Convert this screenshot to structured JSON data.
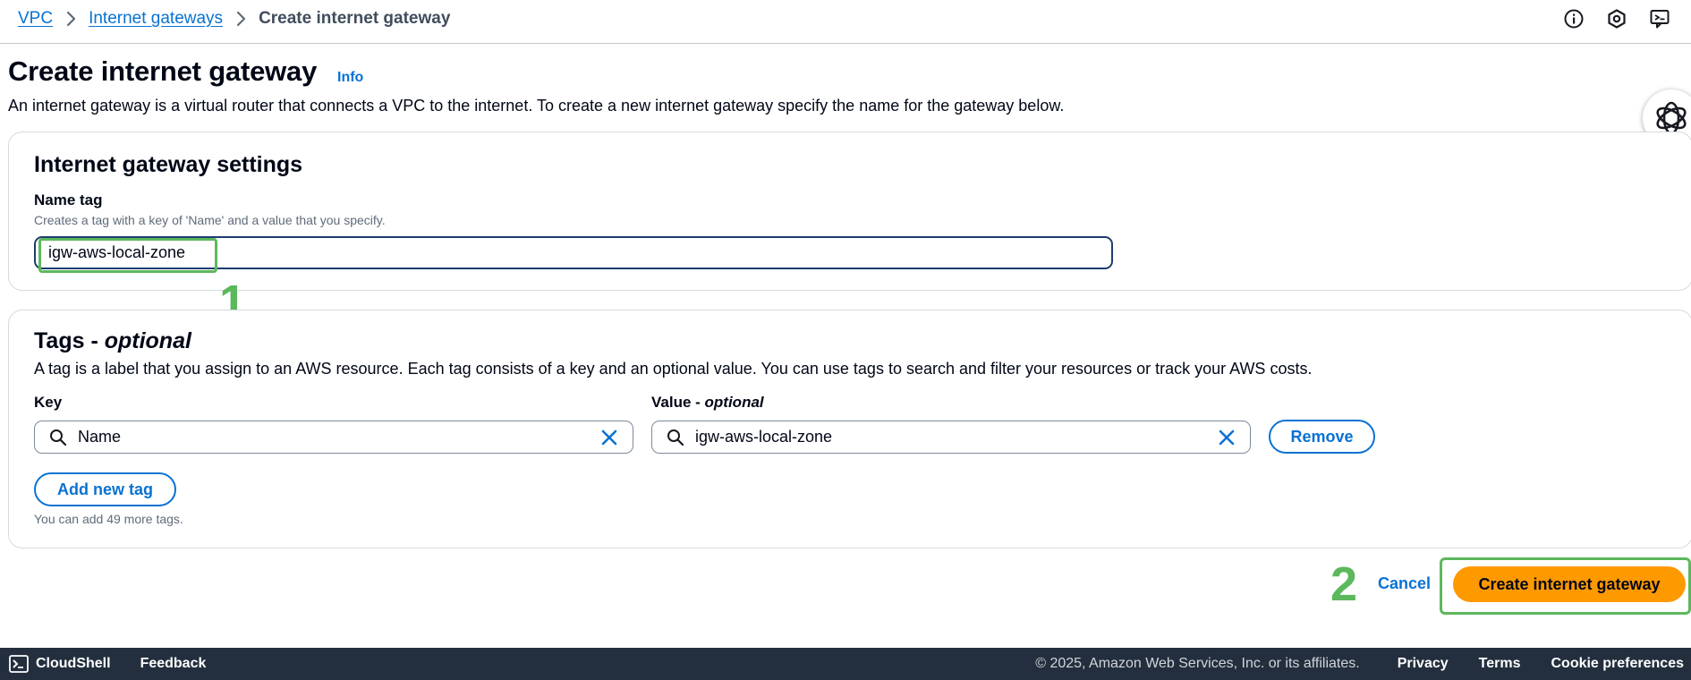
{
  "breadcrumb": {
    "items": [
      {
        "label": "VPC"
      },
      {
        "label": "Internet gateways"
      },
      {
        "label": "Create internet gateway"
      }
    ]
  },
  "header": {
    "title": "Create internet gateway",
    "info": "Info",
    "description": "An internet gateway is a virtual router that connects a VPC to the internet. To create a new internet gateway specify the name for the gateway below."
  },
  "top_icons": [
    "info-circle-icon",
    "settings-hexagon-icon",
    "feedback-chat-icon"
  ],
  "settings": {
    "heading": "Internet gateway settings",
    "name_tag_label": "Name tag",
    "name_tag_description": "Creates a tag with a key of 'Name' and a value that you specify.",
    "name_tag_value": "igw-aws-local-zone"
  },
  "tags": {
    "heading_main": "Tags - ",
    "heading_italic": "optional",
    "description": "A tag is a label that you assign to an AWS resource. Each tag consists of a key and an optional value. You can use tags to search and filter your resources or track your AWS costs.",
    "key_label": "Key",
    "value_label_main": "Value - ",
    "value_label_italic": "optional",
    "rows": [
      {
        "key": "Name",
        "value": "igw-aws-local-zone",
        "remove_label": "Remove"
      }
    ],
    "add_button": "Add new tag",
    "limit_text": "You can add 49 more tags."
  },
  "annotations": {
    "step1": "1",
    "step2": "2",
    "highlight_color": "#5cb85c"
  },
  "actions": {
    "cancel": "Cancel",
    "create": "Create internet gateway"
  },
  "footer": {
    "cloudshell": "CloudShell",
    "feedback": "Feedback",
    "copyright": "© 2025, Amazon Web Services, Inc. or its affiliates.",
    "privacy": "Privacy",
    "terms": "Terms",
    "cookies": "Cookie preferences"
  },
  "colors": {
    "link": "#0972d3",
    "primary_button": "#ff9900",
    "footer_bg": "#232f3e"
  }
}
